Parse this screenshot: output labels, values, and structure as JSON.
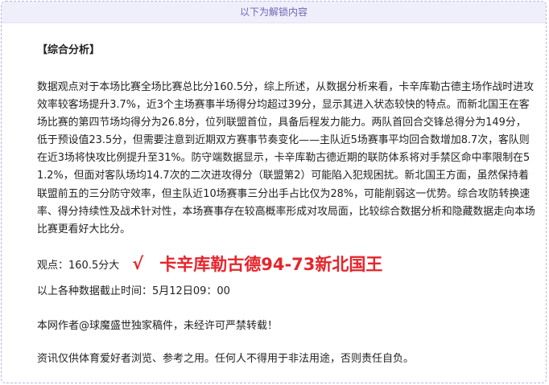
{
  "banner": {
    "text": "以下为解锁内容"
  },
  "article": {
    "section_title": "【综合分析】",
    "paragraph": "数据观点对于本场比赛全场比赛总比分160.5分，综上所述，从数据分析来看，卡辛库勒古德主场作战时进攻效率较客场提升3.7%，近3个主场赛事半场得分均超过39分，显示其进入状态较快的特点。而新北国王在客场比赛的第四节场均得分为26.8分，位列联盟首位，具备后程发力能力。两队首回合交锋总得分为149分，低于预设值23.5分，但需要注意到近期双方赛事节奏变化——主队近5场赛事平均回合数增加8.7次，客队则在近3场将快攻比例提升至31%。防守端数据显示，卡辛库勒古德近期的联防体系将对手禁区命中率限制在51.2%，但面对客队场均14.7次的二次进攻得分（联盟第2）可能陷入犯规困扰。新北国王方面，虽然保持着联盟前五的三分防守效率，但主队近10场赛事三分出手占比仅为28%，可能削弱这一优势。综合攻防转换速率、得分持续性及战术针对性，本场赛事存在较高概率形成对攻局面，比较综合数据分析和隐藏数据走向本场比赛更看好大比分。",
    "prediction_label": "观点：160.5分大",
    "check_mark": "√",
    "prediction_result": "卡辛库勒古德94-73新北国王",
    "data_cutoff": "以上各种数据截止时间：5月12日09：00",
    "copyright": "本网作者@球魔盛世独家稿件，未经许可严禁转载！",
    "disclaimer": "资讯仅供体育爱好者浏览、参考之用。任何人不得用于非法用途，否则责任自负。"
  },
  "colors": {
    "accent_red": "#e6242b",
    "banner_bg": "#efeefb",
    "banner_text": "#6e66b5",
    "border": "#b9b3e0"
  }
}
